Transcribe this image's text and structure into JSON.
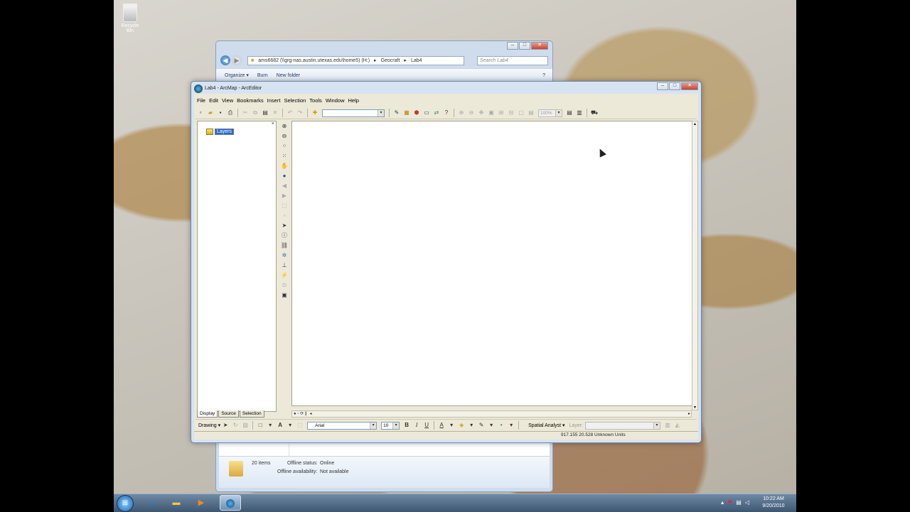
{
  "desktop": {
    "recycle_bin_label": "Recycle Bin"
  },
  "explorer": {
    "address": {
      "path_root": "ams6682 (\\\\grg-nas.austin.utexas.edu\\home5) (H:)",
      "crumb_1": "Geocraft",
      "crumb_2": "Lab4",
      "sep": "▸"
    },
    "search_placeholder": "Search Lab4",
    "toolbar": {
      "organize": "Organize ▾",
      "burn": "Burn",
      "new_folder": "New folder"
    },
    "details": {
      "item_count": "20 items",
      "offline_status_label": "Offline status:",
      "offline_status_value": "Online",
      "offline_availability_label": "Offline availability:",
      "offline_availability_value": "Not available"
    }
  },
  "arcmap": {
    "title": "Lab4 - ArcMap - ArcEditor",
    "menu": [
      "File",
      "Edit",
      "View",
      "Bookmarks",
      "Insert",
      "Selection",
      "Tools",
      "Window",
      "Help"
    ],
    "scale_combo_value": "",
    "zoom_combo_value": "100%",
    "toc": {
      "layers_label": "Layers",
      "close_glyph": "×",
      "tabs": [
        "Display",
        "Source",
        "Selection"
      ]
    },
    "drawing_toolbar": {
      "drawing_label": "Drawing ▾",
      "font_name": "Arial",
      "font_size": "10",
      "bold": "B",
      "italic": "I",
      "underline": "U",
      "spatial_analyst_label": "Spatial Analyst ▾",
      "layer_label": "Layer:"
    },
    "status": {
      "coordinates": "917.155  20.528 Unknown Units"
    }
  },
  "taskbar": {
    "time": "10:22 AM",
    "date": "9/20/2010"
  },
  "colors": {
    "selection_blue": "#316ac5",
    "menu_background": "#ece9d8",
    "title_bar": "#d6e3f2"
  }
}
